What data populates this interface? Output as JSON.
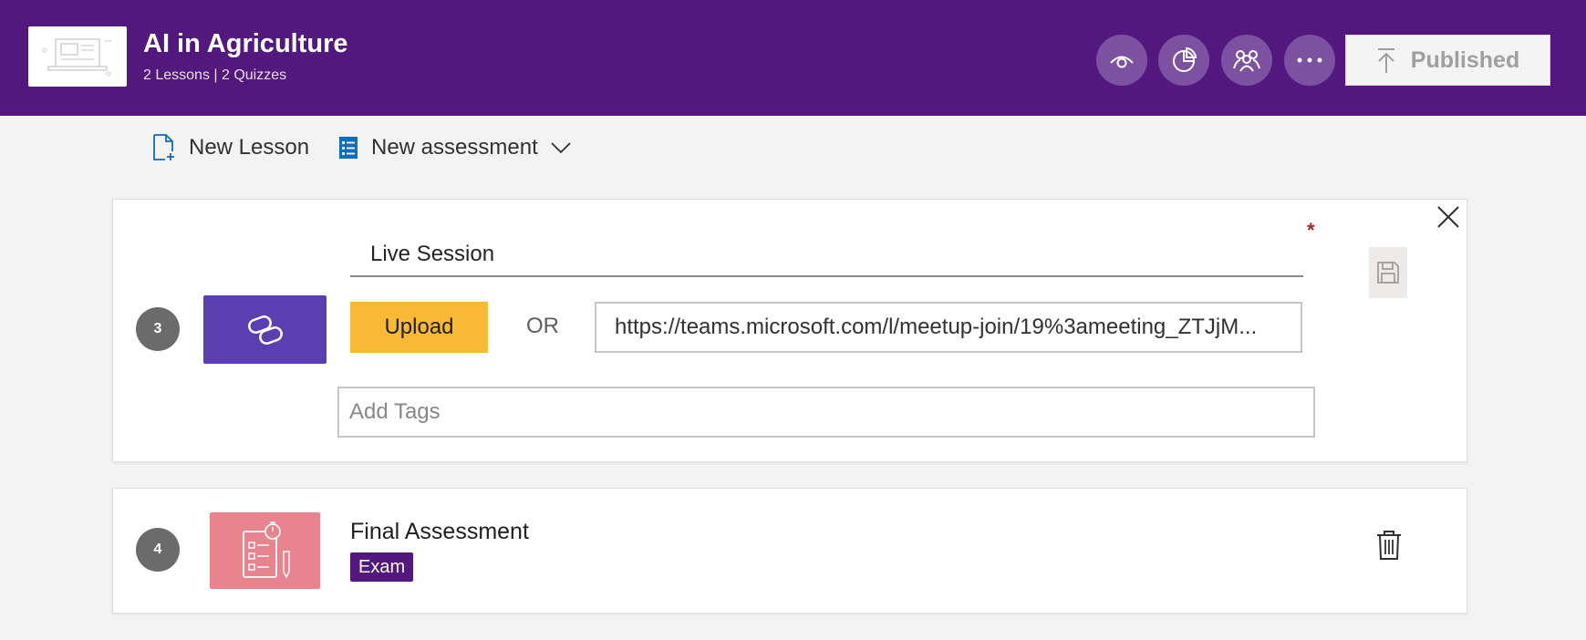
{
  "header": {
    "course_title": "AI in Agriculture",
    "course_subtitle": "2 Lessons | 2 Quizzes",
    "published_label": "Published",
    "icons": [
      "eye-icon",
      "pie-chart-icon",
      "people-icon",
      "more-icon",
      "upload-arrow-icon"
    ],
    "bg_color": "#52187d"
  },
  "toolbar": {
    "new_lesson_label": "New Lesson",
    "new_assessment_label": "New assessment"
  },
  "lesson_edit": {
    "number": "3",
    "title_value": "Live Session",
    "required_mark": "*",
    "upload_label": "Upload",
    "or_label": "OR",
    "url_value": "https://teams.microsoft.com/l/meetup-join/19%3ameeting_ZTJjM...",
    "tags_placeholder": "Add Tags",
    "tile_color": "#5b3fb0",
    "upload_color": "#f9b935"
  },
  "assessment": {
    "number": "4",
    "title": "Final Assessment",
    "badge": "Exam",
    "tile_color": "#e9838d"
  }
}
